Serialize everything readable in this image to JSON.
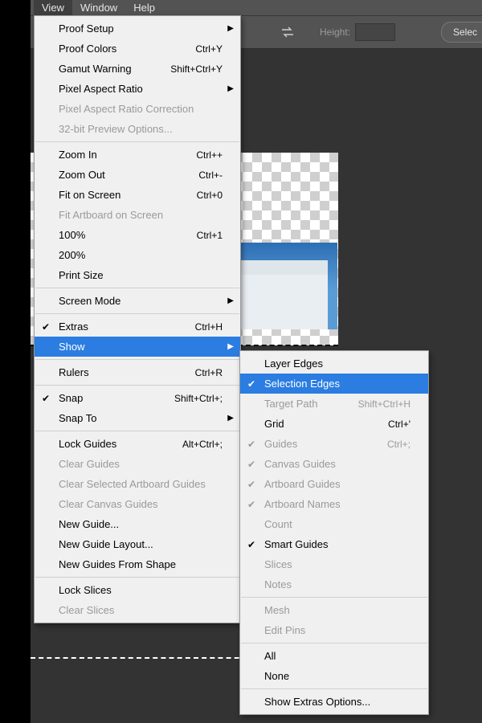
{
  "menubar": {
    "items": [
      "View",
      "Window",
      "Help"
    ],
    "active": 0
  },
  "optionsbar": {
    "height_label": "Height:",
    "select_button": "Selec"
  },
  "view_menu": [
    {
      "t": "item",
      "label": "Proof Setup",
      "submenu": true
    },
    {
      "t": "item",
      "label": "Proof Colors",
      "shortcut": "Ctrl+Y"
    },
    {
      "t": "item",
      "label": "Gamut Warning",
      "shortcut": "Shift+Ctrl+Y"
    },
    {
      "t": "item",
      "label": "Pixel Aspect Ratio",
      "submenu": true
    },
    {
      "t": "item",
      "label": "Pixel Aspect Ratio Correction",
      "disabled": true
    },
    {
      "t": "item",
      "label": "32-bit Preview Options...",
      "disabled": true
    },
    {
      "t": "sep"
    },
    {
      "t": "item",
      "label": "Zoom In",
      "shortcut": "Ctrl++"
    },
    {
      "t": "item",
      "label": "Zoom Out",
      "shortcut": "Ctrl+-"
    },
    {
      "t": "item",
      "label": "Fit on Screen",
      "shortcut": "Ctrl+0"
    },
    {
      "t": "item",
      "label": "Fit Artboard on Screen",
      "disabled": true
    },
    {
      "t": "item",
      "label": "100%",
      "shortcut": "Ctrl+1"
    },
    {
      "t": "item",
      "label": "200%"
    },
    {
      "t": "item",
      "label": "Print Size"
    },
    {
      "t": "sep"
    },
    {
      "t": "item",
      "label": "Screen Mode",
      "submenu": true
    },
    {
      "t": "sep"
    },
    {
      "t": "item",
      "label": "Extras",
      "shortcut": "Ctrl+H",
      "checked": true
    },
    {
      "t": "item",
      "label": "Show",
      "submenu": true,
      "hover": true
    },
    {
      "t": "sep"
    },
    {
      "t": "item",
      "label": "Rulers",
      "shortcut": "Ctrl+R"
    },
    {
      "t": "sep"
    },
    {
      "t": "item",
      "label": "Snap",
      "shortcut": "Shift+Ctrl+;",
      "checked": true
    },
    {
      "t": "item",
      "label": "Snap To",
      "submenu": true
    },
    {
      "t": "sep"
    },
    {
      "t": "item",
      "label": "Lock Guides",
      "shortcut": "Alt+Ctrl+;"
    },
    {
      "t": "item",
      "label": "Clear Guides",
      "disabled": true
    },
    {
      "t": "item",
      "label": "Clear Selected Artboard Guides",
      "disabled": true
    },
    {
      "t": "item",
      "label": "Clear Canvas Guides",
      "disabled": true
    },
    {
      "t": "item",
      "label": "New Guide..."
    },
    {
      "t": "item",
      "label": "New Guide Layout..."
    },
    {
      "t": "item",
      "label": "New Guides From Shape"
    },
    {
      "t": "sep"
    },
    {
      "t": "item",
      "label": "Lock Slices"
    },
    {
      "t": "item",
      "label": "Clear Slices",
      "disabled": true
    }
  ],
  "show_submenu": [
    {
      "t": "item",
      "label": "Layer Edges"
    },
    {
      "t": "item",
      "label": "Selection Edges",
      "checked": true,
      "hover": true
    },
    {
      "t": "item",
      "label": "Target Path",
      "shortcut": "Shift+Ctrl+H",
      "disabled": true
    },
    {
      "t": "item",
      "label": "Grid",
      "shortcut": "Ctrl+'"
    },
    {
      "t": "item",
      "label": "Guides",
      "shortcut": "Ctrl+;",
      "checked": true,
      "disabled": true
    },
    {
      "t": "item",
      "label": "Canvas Guides",
      "checked": true,
      "disabled": true
    },
    {
      "t": "item",
      "label": "Artboard Guides",
      "checked": true,
      "disabled": true
    },
    {
      "t": "item",
      "label": "Artboard Names",
      "checked": true,
      "disabled": true
    },
    {
      "t": "item",
      "label": "Count",
      "disabled": true
    },
    {
      "t": "item",
      "label": "Smart Guides",
      "checked": true
    },
    {
      "t": "item",
      "label": "Slices",
      "disabled": true
    },
    {
      "t": "item",
      "label": "Notes",
      "disabled": true
    },
    {
      "t": "sep"
    },
    {
      "t": "item",
      "label": "Mesh",
      "disabled": true
    },
    {
      "t": "item",
      "label": "Edit Pins",
      "disabled": true
    },
    {
      "t": "sep"
    },
    {
      "t": "item",
      "label": "All"
    },
    {
      "t": "item",
      "label": "None"
    },
    {
      "t": "sep"
    },
    {
      "t": "item",
      "label": "Show Extras Options..."
    }
  ]
}
